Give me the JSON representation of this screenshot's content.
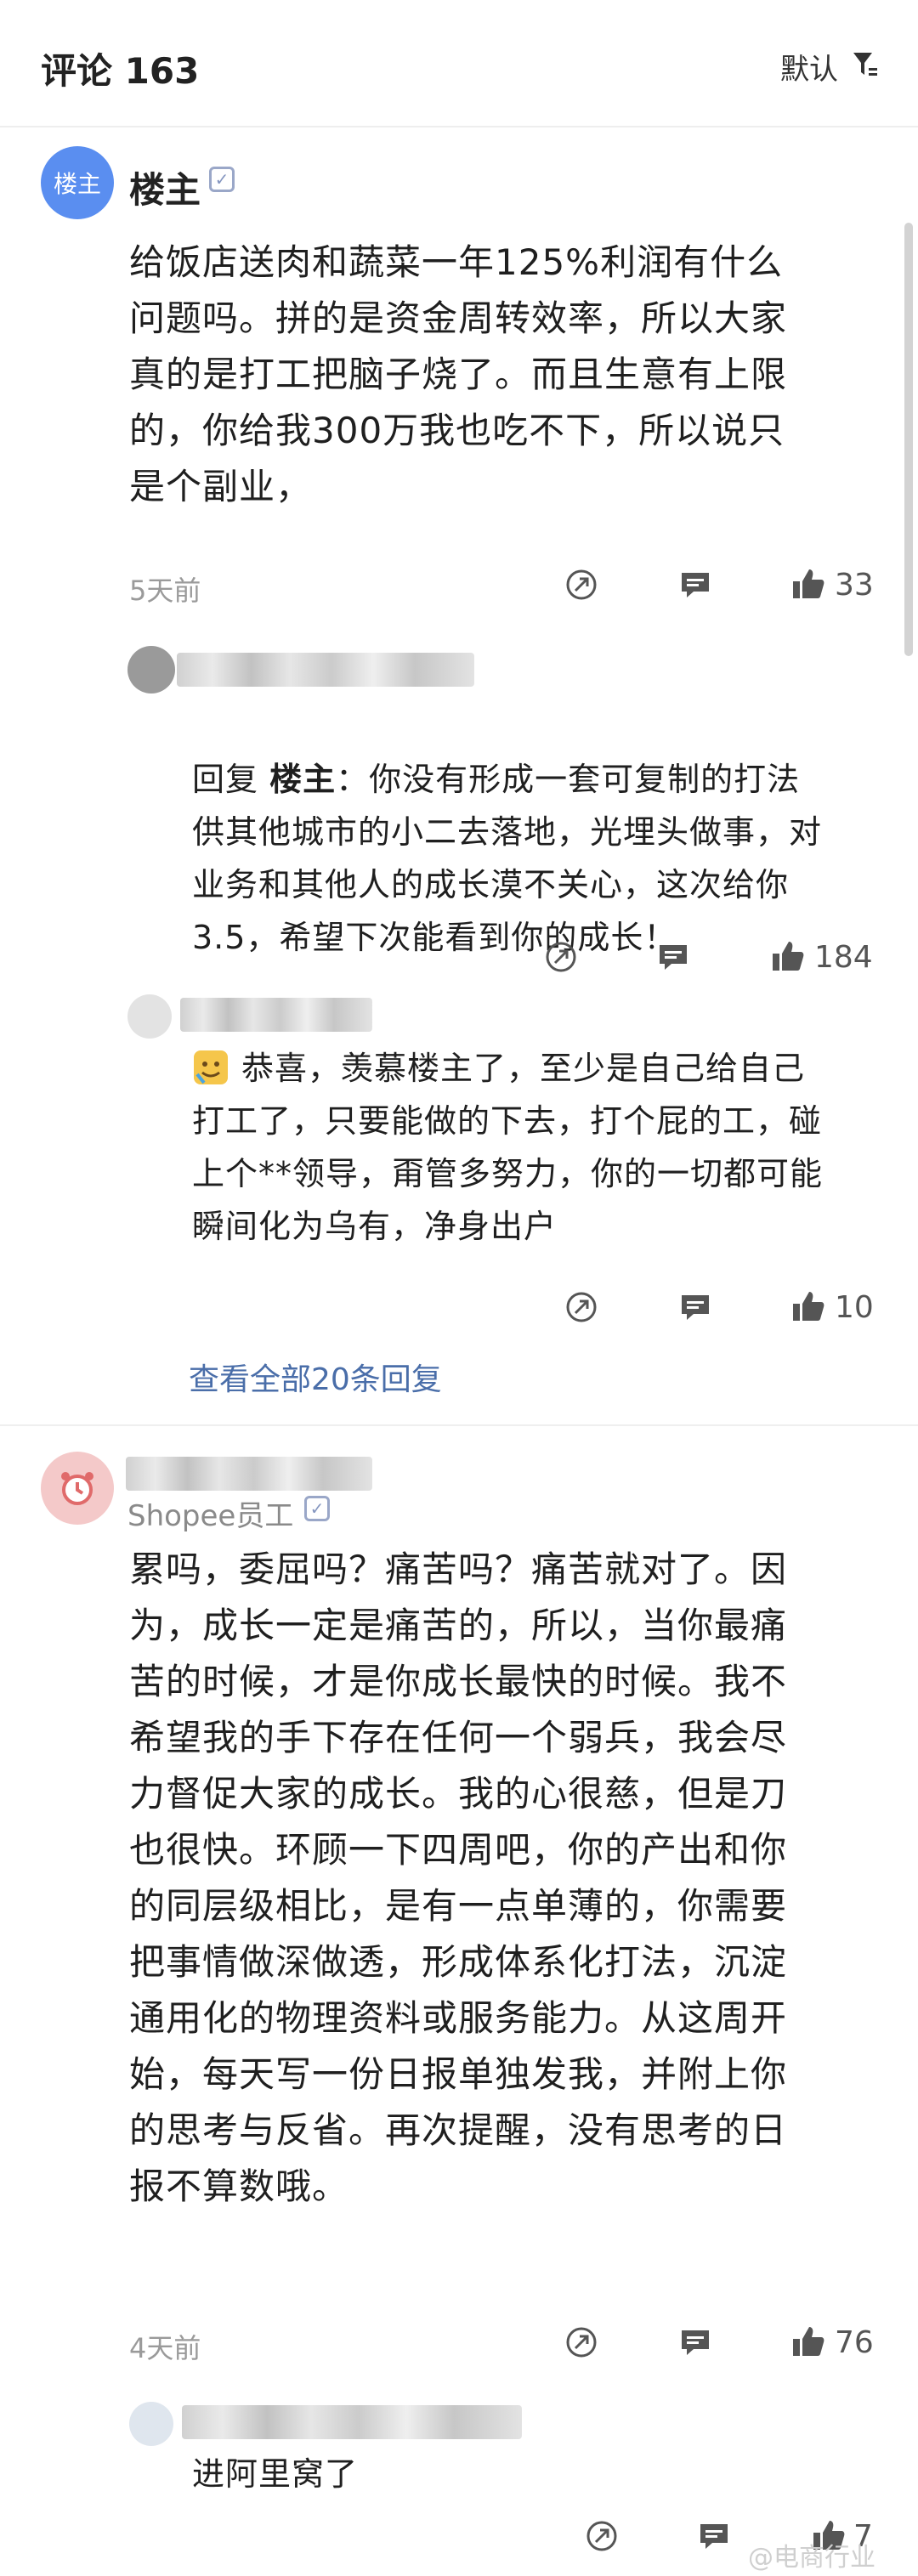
{
  "header": {
    "title": "评论 163",
    "sort_label": "默认"
  },
  "thread1": {
    "avatar_text": "楼主",
    "author": "楼主",
    "verified_mark": "✓",
    "body": "给饭店送肉和蔬菜一年125%利润有什么\n问题吗。拼的是资金周转效率，所以大家\n真的是打工把脑子烧了。而且生意有上限\n的，你给我300万我也吃不下，所以说只\n是个副业，",
    "time": "5天前",
    "likes": "33",
    "replies": [
      {
        "prefix": "回复 ",
        "target": "楼主",
        "colon": "：",
        "text": "你没有形成一套可复制的打法\n供其他城市的小二去落地，光埋头做事，对\n业务和其他人的成长漠不关心，这次给你\n3.5，希望下次能看到你的成长！",
        "likes": "184"
      },
      {
        "text": "恭喜，羡慕楼主了，至少是自己给自己\n打工了，只要能做的下去，打个屁的工，碰\n上个**领导，甭管多努力，你的一切都可能\n瞬间化为乌有，净身出户",
        "likes": "10"
      }
    ],
    "view_all": "查看全部20条回复"
  },
  "thread2": {
    "subtitle": "Shopee员工",
    "verified_mark": "✓",
    "body": "累吗，委屈吗？痛苦吗？痛苦就对了。因\n为，成长一定是痛苦的，所以，当你最痛\n苦的时候，才是你成长最快的时候。我不\n希望我的手下存在任何一个弱兵，我会尽\n力督促大家的成长。我的心很慈，但是刀\n也很快。环顾一下四周吧，你的产出和你\n的同层级相比，是有一点单薄的，你需要\n把事情做深做透，形成体系化打法，沉淀\n通用化的物理资料或服务能力。从这周开\n始，每天写一份日报单独发我，并附上你\n的思考与反省。再次提醒，没有思考的日\n报不算数哦。",
    "time": "4天前",
    "likes": "76",
    "replies": [
      {
        "text": "进阿里窝了",
        "likes": "7"
      }
    ]
  },
  "watermark": "@电商行业",
  "colors": {
    "accent_link": "#4a6ea9",
    "avatar_blue": "#5a8ef0",
    "avatar_pink": "#f4c9c9"
  },
  "icons": [
    "filter-icon",
    "share-icon",
    "comment-icon",
    "like-icon",
    "clock-avatar-icon",
    "verified-icon"
  ]
}
